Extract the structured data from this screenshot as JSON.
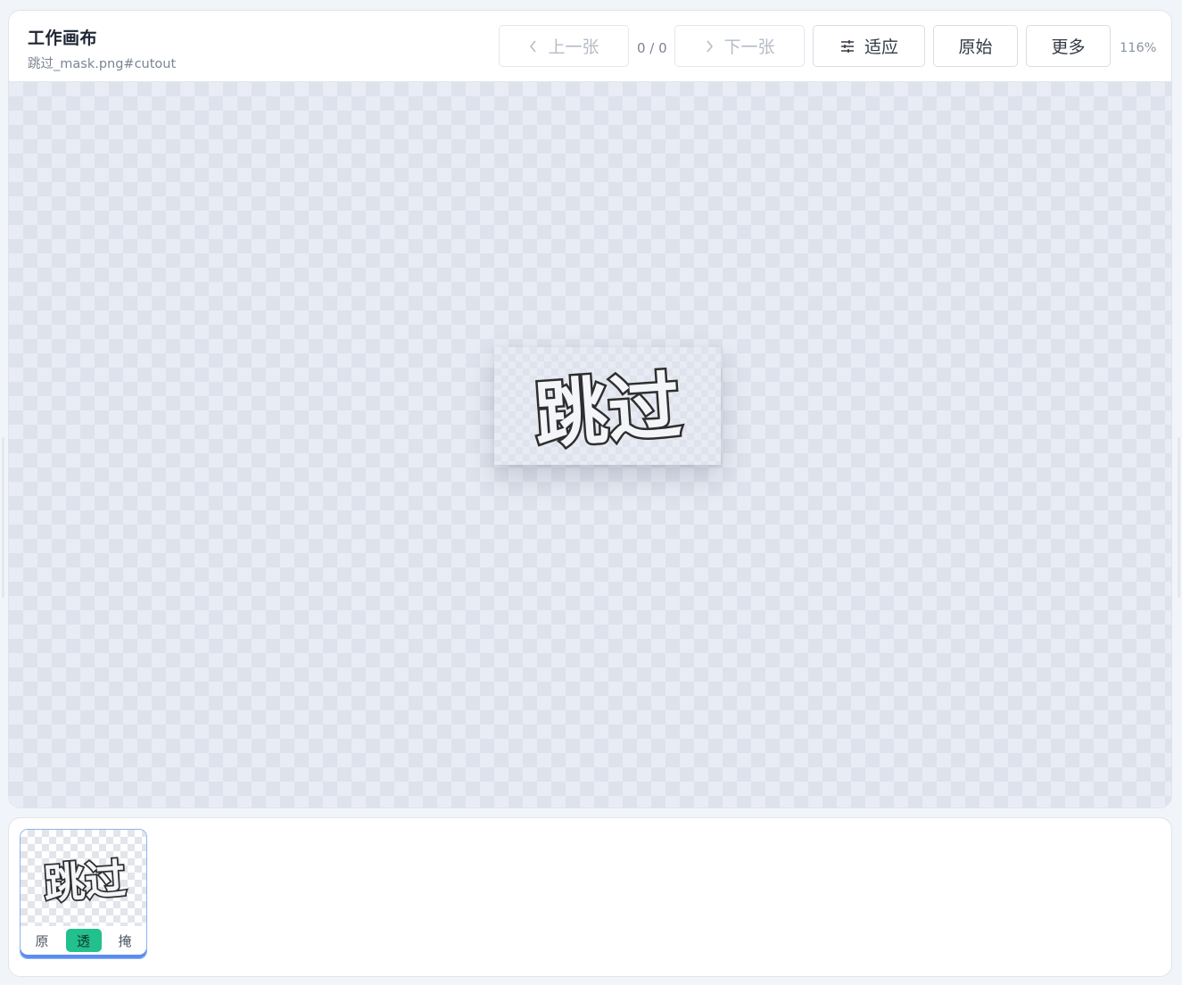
{
  "header": {
    "title": "工作画布",
    "subtitle": "跳过_mask.png#cutout"
  },
  "toolbar": {
    "prev_label": "上一张",
    "counter": "0 / 0",
    "next_label": "下一张",
    "fit_label": "适应",
    "original_label": "原始",
    "more_label": "更多",
    "zoom": "116%"
  },
  "canvas": {
    "image_text": "跳过"
  },
  "filmstrip": {
    "items": [
      {
        "image_text": "跳过",
        "modes": [
          "原",
          "透",
          "掩"
        ],
        "active_mode": "透"
      }
    ]
  },
  "colors": {
    "accent": "#5b8def",
    "active_mode": "#22c08c",
    "ink": "#2e2e2e"
  }
}
